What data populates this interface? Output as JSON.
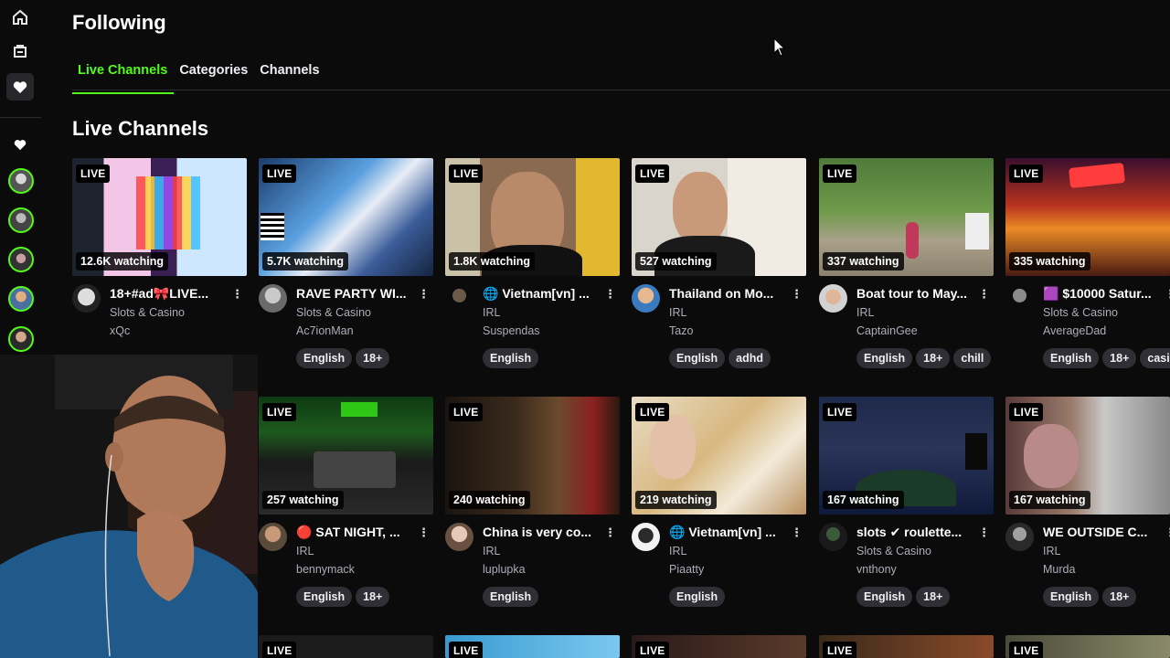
{
  "sidebar": {
    "home_icon": "home-icon",
    "browse_icon": "browse-icon",
    "following_icon": "heart-icon",
    "live_indicator": "(•)"
  },
  "header": {
    "title": "Following",
    "tabs": [
      {
        "label": "Live Channels",
        "active": true
      },
      {
        "label": "Categories",
        "active": false
      },
      {
        "label": "Channels",
        "active": false
      }
    ]
  },
  "section": {
    "title": "Live Channels"
  },
  "live_label": "LIVE",
  "streams": [
    {
      "viewers": "12.6K watching",
      "title": "18+#ad🎀LIVE...",
      "category": "Slots & Casino",
      "streamer": "xQc",
      "tags": [],
      "visible": true
    },
    {
      "viewers": "5.7K watching",
      "title": "RAVE PARTY WI...",
      "category": "Slots & Casino",
      "streamer": "Ac7ionMan",
      "tags": [
        "English",
        "18+"
      ],
      "visible": true
    },
    {
      "viewers": "1.8K watching",
      "title": "🌐 Vietnam[vn] ...",
      "category": "IRL",
      "streamer": "Suspendas",
      "tags": [
        "English"
      ],
      "visible": true
    },
    {
      "viewers": "527 watching",
      "title": "Thailand on Mo...",
      "category": "IRL",
      "streamer": "Tazo",
      "tags": [
        "English",
        "adhd"
      ],
      "visible": true
    },
    {
      "viewers": "337 watching",
      "title": "Boat tour to May...",
      "category": "IRL",
      "streamer": "CaptainGee",
      "tags": [
        "English",
        "18+",
        "chill"
      ],
      "visible": true
    },
    {
      "viewers": "335 watching",
      "title": "🟪 $10000 Satur...",
      "category": "Slots & Casino",
      "streamer": "AverageDad",
      "tags": [
        "English",
        "18+",
        "casino"
      ],
      "visible": true
    },
    {
      "viewers": "257 watching",
      "title": "🔴 SAT NIGHT, ...",
      "category": "IRL",
      "streamer": "bennymack",
      "tags": [
        "English",
        "18+"
      ],
      "visible": true
    },
    {
      "viewers": "240 watching",
      "title": "China is very co...",
      "category": "IRL",
      "streamer": "luplupka",
      "tags": [
        "English"
      ],
      "visible": true
    },
    {
      "viewers": "219 watching",
      "title": "🌐 Vietnam[vn] ...",
      "category": "IRL",
      "streamer": "Piaatty",
      "tags": [
        "English"
      ],
      "visible": true
    },
    {
      "viewers": "167 watching",
      "title": "slots ✔ roulette...",
      "category": "Slots & Casino",
      "streamer": "vnthony",
      "tags": [
        "English",
        "18+"
      ],
      "visible": true
    },
    {
      "viewers": "167 watching",
      "title": "WE OUTSIDE C...",
      "category": "IRL",
      "streamer": "Murda",
      "tags": [
        "English",
        "18+"
      ],
      "visible": true
    }
  ],
  "colors": {
    "accent": "#53fc18",
    "background": "#0b0b0c",
    "tag_bg": "#2f2f35"
  }
}
